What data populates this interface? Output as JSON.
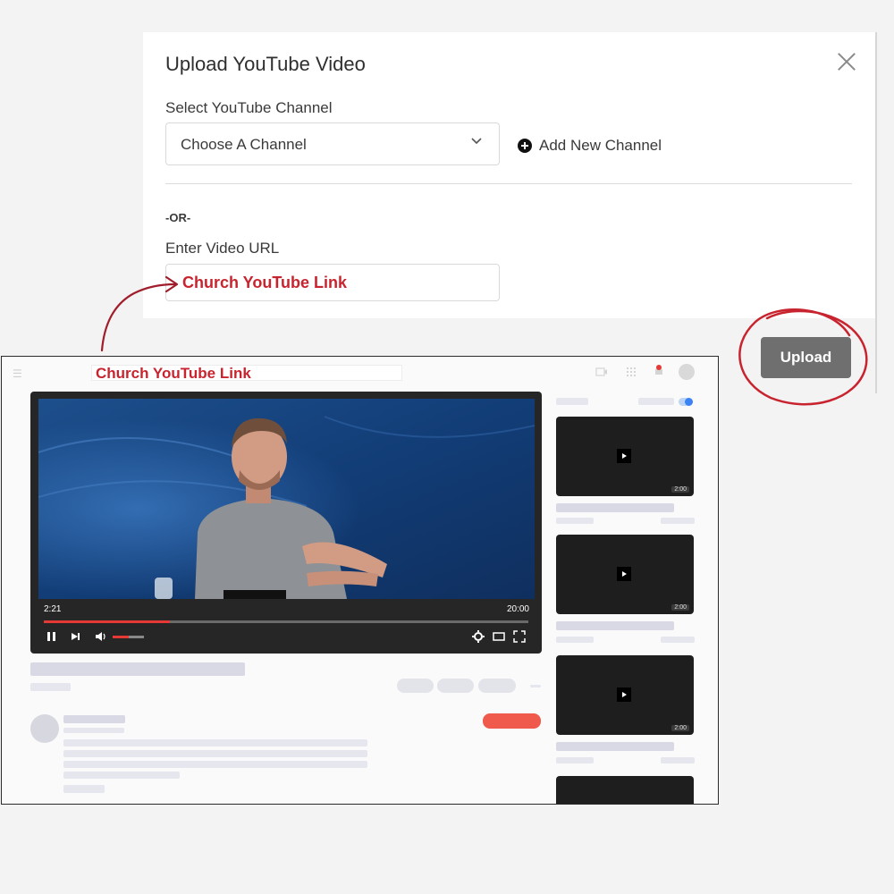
{
  "modal": {
    "title": "Upload YouTube Video",
    "channel_label": "Select YouTube Channel",
    "channel_select_value": "Choose A Channel",
    "add_channel_label": "Add New Channel",
    "or_label": "-OR-",
    "url_label": "Enter Video URL",
    "url_value": "Church YouTube Link",
    "upload_label": "Upload"
  },
  "youtube_mock": {
    "search_text": "Church YouTube Link",
    "player": {
      "current_time": "2:21",
      "total_time": "20:00",
      "progress": 0.26,
      "volume": 0.5
    },
    "sidebar_videos": [
      {
        "duration": "2:00"
      },
      {
        "duration": "2:00"
      },
      {
        "duration": "2:00"
      }
    ]
  },
  "colors": {
    "accent_red": "#c8242f",
    "upload_button": "#6f6f6f",
    "progress_red": "#e53935"
  },
  "icons": [
    "close-icon",
    "chevron-down-icon",
    "plus-circle-icon",
    "menu-icon",
    "pause-icon",
    "next-icon",
    "volume-icon",
    "settings-icon",
    "theater-icon",
    "fullscreen-icon",
    "play-icon"
  ]
}
